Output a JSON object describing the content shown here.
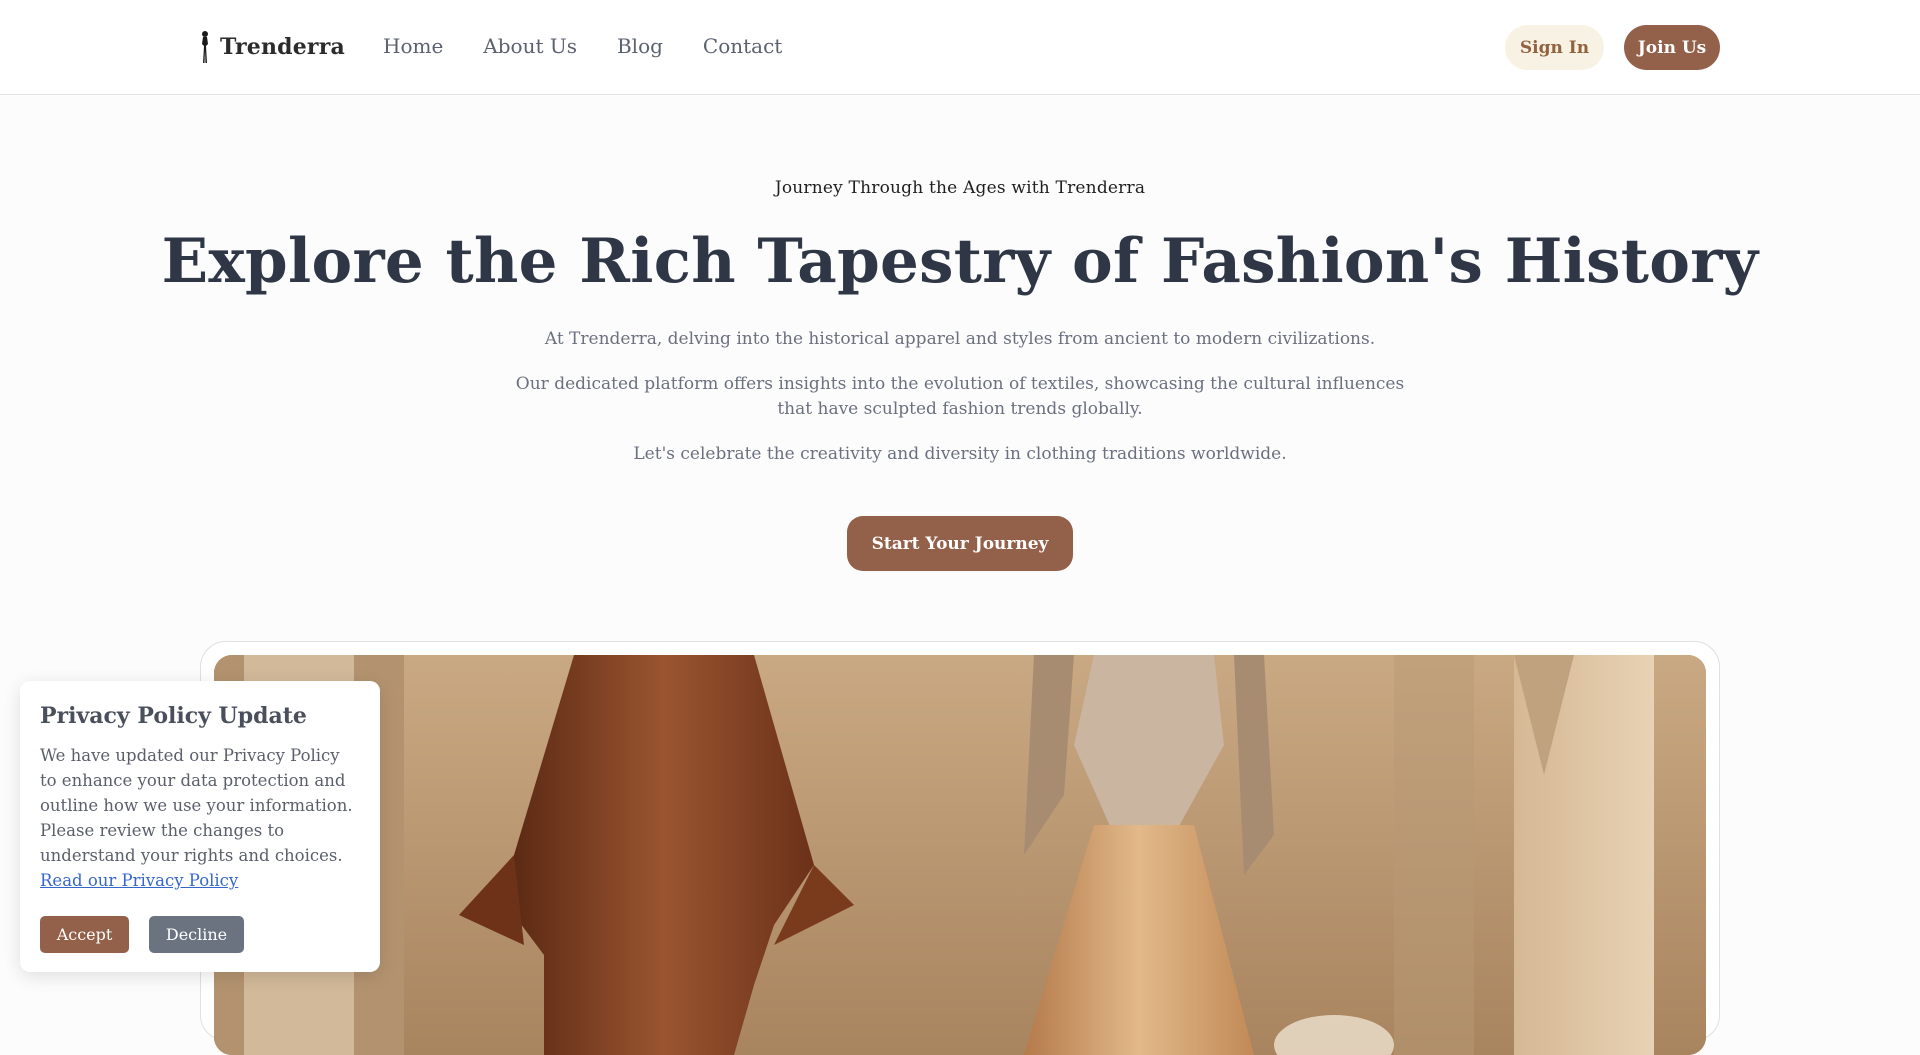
{
  "header": {
    "logo_text": "Trenderra",
    "logo_icon": "woman-silhouette-icon",
    "nav": [
      {
        "label": "Home"
      },
      {
        "label": "About Us"
      },
      {
        "label": "Blog"
      },
      {
        "label": "Contact"
      }
    ],
    "sign_in_label": "Sign In",
    "join_label": "Join Us"
  },
  "hero": {
    "eyebrow": "Journey Through the Ages with Trenderra",
    "title": "Explore the Rich Tapestry of Fashion's History",
    "para1": "At Trenderra, delving into the historical apparel and styles from ancient to modern civilizations.",
    "para2_line1": "Our dedicated platform offers insights into the evolution of textiles, showcasing the cultural influences",
    "para2_line2": "that have sculpted fashion trends globally.",
    "para3": "Let's celebrate the creativity and diversity in clothing traditions worldwide.",
    "cta_label": "Start Your Journey"
  },
  "privacy": {
    "title": "Privacy Policy Update",
    "body": "We have updated our Privacy Policy to enhance your data protection and outline how we use your information. Please review the changes to understand your rights and choices.",
    "link_label": "Read our Privacy Policy",
    "accept_label": "Accept",
    "decline_label": "Decline"
  },
  "colors": {
    "brand_brown": "#93604a",
    "sign_in_bg": "#f7f2e3",
    "link_blue": "#3567c8",
    "decline_gray": "#6b7280"
  }
}
